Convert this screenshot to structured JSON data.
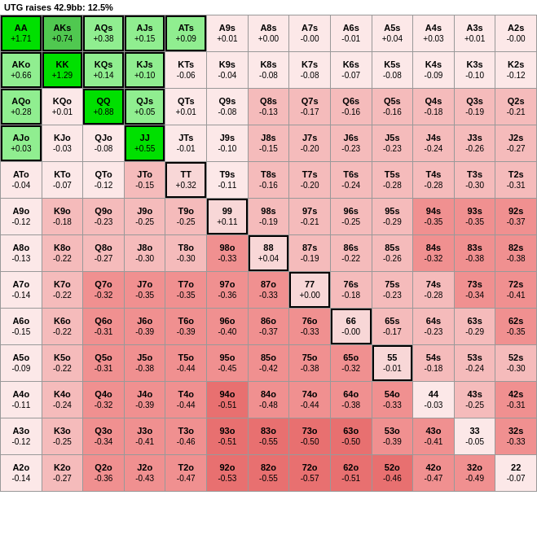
{
  "header": {
    "text": "UTG raises 42.9bb: 12.5%"
  },
  "cells": [
    {
      "name": "AA",
      "val": "+1.71",
      "style": "green-bright"
    },
    {
      "name": "AKs",
      "val": "+0.74",
      "style": "green-mid"
    },
    {
      "name": "AQs",
      "val": "+0.38",
      "style": "green-light"
    },
    {
      "name": "AJs",
      "val": "+0.15",
      "style": "green-light"
    },
    {
      "name": "ATs",
      "val": "+0.09",
      "style": "green-light"
    },
    {
      "name": "A9s",
      "val": "+0.01",
      "style": "pink-light"
    },
    {
      "name": "A8s",
      "val": "+0.00",
      "style": "pink-light"
    },
    {
      "name": "A7s",
      "val": "-0.00",
      "style": "pink-light"
    },
    {
      "name": "A6s",
      "val": "-0.01",
      "style": "pink-light"
    },
    {
      "name": "A5s",
      "val": "+0.04",
      "style": "pink-light"
    },
    {
      "name": "A4s",
      "val": "+0.03",
      "style": "pink-light"
    },
    {
      "name": "A3s",
      "val": "+0.01",
      "style": "pink-light"
    },
    {
      "name": "A2s",
      "val": "-0.00",
      "style": "pink-light"
    },
    {
      "name": "AKo",
      "val": "+0.66",
      "style": "green-light"
    },
    {
      "name": "KK",
      "val": "+1.29",
      "style": "green-bright"
    },
    {
      "name": "KQs",
      "val": "+0.14",
      "style": "green-light"
    },
    {
      "name": "KJs",
      "val": "+0.10",
      "style": "green-light"
    },
    {
      "name": "KTs",
      "val": "-0.06",
      "style": "pink-light"
    },
    {
      "name": "K9s",
      "val": "-0.04",
      "style": "pink-light"
    },
    {
      "name": "K8s",
      "val": "-0.08",
      "style": "pink-light"
    },
    {
      "name": "K7s",
      "val": "-0.08",
      "style": "pink-light"
    },
    {
      "name": "K6s",
      "val": "-0.07",
      "style": "pink-light"
    },
    {
      "name": "K5s",
      "val": "-0.08",
      "style": "pink-light"
    },
    {
      "name": "K4s",
      "val": "-0.09",
      "style": "pink-light"
    },
    {
      "name": "K3s",
      "val": "-0.10",
      "style": "pink-light"
    },
    {
      "name": "K2s",
      "val": "-0.12",
      "style": "pink-light"
    },
    {
      "name": "AQo",
      "val": "+0.28",
      "style": "green-light"
    },
    {
      "name": "KQo",
      "val": "+0.01",
      "style": "pink-light"
    },
    {
      "name": "QQ",
      "val": "+0.88",
      "style": "green-bright"
    },
    {
      "name": "QJs",
      "val": "+0.05",
      "style": "green-light"
    },
    {
      "name": "QTs",
      "val": "+0.01",
      "style": "pink-light"
    },
    {
      "name": "Q9s",
      "val": "-0.08",
      "style": "pink-light"
    },
    {
      "name": "Q8s",
      "val": "-0.13",
      "style": "pink-med"
    },
    {
      "name": "Q7s",
      "val": "-0.17",
      "style": "pink-med"
    },
    {
      "name": "Q6s",
      "val": "-0.16",
      "style": "pink-med"
    },
    {
      "name": "Q5s",
      "val": "-0.16",
      "style": "pink-med"
    },
    {
      "name": "Q4s",
      "val": "-0.18",
      "style": "pink-med"
    },
    {
      "name": "Q3s",
      "val": "-0.19",
      "style": "pink-med"
    },
    {
      "name": "Q2s",
      "val": "-0.21",
      "style": "pink-med"
    },
    {
      "name": "AJo",
      "val": "+0.03",
      "style": "green-light"
    },
    {
      "name": "KJo",
      "val": "-0.03",
      "style": "pink-light"
    },
    {
      "name": "QJo",
      "val": "-0.08",
      "style": "pink-light"
    },
    {
      "name": "JJ",
      "val": "+0.55",
      "style": "green-bright"
    },
    {
      "name": "JTs",
      "val": "-0.01",
      "style": "pink-light"
    },
    {
      "name": "J9s",
      "val": "-0.10",
      "style": "pink-light"
    },
    {
      "name": "J8s",
      "val": "-0.15",
      "style": "pink-med"
    },
    {
      "name": "J7s",
      "val": "-0.20",
      "style": "pink-med"
    },
    {
      "name": "J6s",
      "val": "-0.23",
      "style": "pink-med"
    },
    {
      "name": "J5s",
      "val": "-0.23",
      "style": "pink-med"
    },
    {
      "name": "J4s",
      "val": "-0.24",
      "style": "pink-med"
    },
    {
      "name": "J3s",
      "val": "-0.26",
      "style": "pink-med"
    },
    {
      "name": "J2s",
      "val": "-0.27",
      "style": "pink-med"
    },
    {
      "name": "ATo",
      "val": "-0.04",
      "style": "pink-light"
    },
    {
      "name": "KTo",
      "val": "-0.07",
      "style": "pink-light"
    },
    {
      "name": "QTo",
      "val": "-0.12",
      "style": "pink-light"
    },
    {
      "name": "JTo",
      "val": "-0.15",
      "style": "pink-med"
    },
    {
      "name": "TT",
      "val": "+0.32",
      "style": "outlined"
    },
    {
      "name": "T9s",
      "val": "-0.11",
      "style": "pink-light"
    },
    {
      "name": "T8s",
      "val": "-0.16",
      "style": "pink-med"
    },
    {
      "name": "T7s",
      "val": "-0.20",
      "style": "pink-med"
    },
    {
      "name": "T6s",
      "val": "-0.24",
      "style": "pink-med"
    },
    {
      "name": "T5s",
      "val": "-0.28",
      "style": "pink-med"
    },
    {
      "name": "T4s",
      "val": "-0.28",
      "style": "pink-med"
    },
    {
      "name": "T3s",
      "val": "-0.30",
      "style": "pink-med"
    },
    {
      "name": "T2s",
      "val": "-0.31",
      "style": "pink-med"
    },
    {
      "name": "A9o",
      "val": "-0.12",
      "style": "pink-light"
    },
    {
      "name": "K9o",
      "val": "-0.18",
      "style": "pink-med"
    },
    {
      "name": "Q9o",
      "val": "-0.23",
      "style": "pink-med"
    },
    {
      "name": "J9o",
      "val": "-0.25",
      "style": "pink-med"
    },
    {
      "name": "T9o",
      "val": "-0.25",
      "style": "pink-med"
    },
    {
      "name": "99",
      "val": "+0.11",
      "style": "outlined"
    },
    {
      "name": "98s",
      "val": "-0.19",
      "style": "pink-med"
    },
    {
      "name": "97s",
      "val": "-0.21",
      "style": "pink-med"
    },
    {
      "name": "96s",
      "val": "-0.25",
      "style": "pink-med"
    },
    {
      "name": "95s",
      "val": "-0.29",
      "style": "pink-med"
    },
    {
      "name": "94s",
      "val": "-0.35",
      "style": "pink-dark"
    },
    {
      "name": "93s",
      "val": "-0.35",
      "style": "pink-dark"
    },
    {
      "name": "92s",
      "val": "-0.37",
      "style": "pink-dark"
    },
    {
      "name": "A8o",
      "val": "-0.13",
      "style": "pink-light"
    },
    {
      "name": "K8o",
      "val": "-0.22",
      "style": "pink-med"
    },
    {
      "name": "Q8o",
      "val": "-0.27",
      "style": "pink-med"
    },
    {
      "name": "J8o",
      "val": "-0.30",
      "style": "pink-med"
    },
    {
      "name": "T8o",
      "val": "-0.30",
      "style": "pink-med"
    },
    {
      "name": "98o",
      "val": "-0.33",
      "style": "pink-dark"
    },
    {
      "name": "88",
      "val": "+0.04",
      "style": "outlined"
    },
    {
      "name": "87s",
      "val": "-0.19",
      "style": "pink-med"
    },
    {
      "name": "86s",
      "val": "-0.22",
      "style": "pink-med"
    },
    {
      "name": "85s",
      "val": "-0.26",
      "style": "pink-med"
    },
    {
      "name": "84s",
      "val": "-0.32",
      "style": "pink-dark"
    },
    {
      "name": "83s",
      "val": "-0.38",
      "style": "pink-dark"
    },
    {
      "name": "82s",
      "val": "-0.38",
      "style": "pink-dark"
    },
    {
      "name": "A7o",
      "val": "-0.14",
      "style": "pink-light"
    },
    {
      "name": "K7o",
      "val": "-0.22",
      "style": "pink-med"
    },
    {
      "name": "Q7o",
      "val": "-0.32",
      "style": "pink-dark"
    },
    {
      "name": "J7o",
      "val": "-0.35",
      "style": "pink-dark"
    },
    {
      "name": "T7o",
      "val": "-0.35",
      "style": "pink-dark"
    },
    {
      "name": "97o",
      "val": "-0.36",
      "style": "pink-dark"
    },
    {
      "name": "87o",
      "val": "-0.33",
      "style": "pink-dark"
    },
    {
      "name": "77",
      "val": "+0.00",
      "style": "outlined"
    },
    {
      "name": "76s",
      "val": "-0.18",
      "style": "pink-med"
    },
    {
      "name": "75s",
      "val": "-0.23",
      "style": "pink-med"
    },
    {
      "name": "74s",
      "val": "-0.28",
      "style": "pink-med"
    },
    {
      "name": "73s",
      "val": "-0.34",
      "style": "pink-dark"
    },
    {
      "name": "72s",
      "val": "-0.41",
      "style": "pink-dark"
    },
    {
      "name": "A6o",
      "val": "-0.15",
      "style": "pink-light"
    },
    {
      "name": "K6o",
      "val": "-0.22",
      "style": "pink-med"
    },
    {
      "name": "Q6o",
      "val": "-0.31",
      "style": "pink-dark"
    },
    {
      "name": "J6o",
      "val": "-0.39",
      "style": "pink-dark"
    },
    {
      "name": "T6o",
      "val": "-0.39",
      "style": "pink-dark"
    },
    {
      "name": "96o",
      "val": "-0.40",
      "style": "pink-dark"
    },
    {
      "name": "86o",
      "val": "-0.37",
      "style": "pink-dark"
    },
    {
      "name": "76o",
      "val": "-0.33",
      "style": "pink-dark"
    },
    {
      "name": "66",
      "val": "-0.00",
      "style": "outlined"
    },
    {
      "name": "65s",
      "val": "-0.17",
      "style": "pink-med"
    },
    {
      "name": "64s",
      "val": "-0.23",
      "style": "pink-med"
    },
    {
      "name": "63s",
      "val": "-0.29",
      "style": "pink-med"
    },
    {
      "name": "62s",
      "val": "-0.35",
      "style": "pink-dark"
    },
    {
      "name": "A5o",
      "val": "-0.09",
      "style": "pink-light"
    },
    {
      "name": "K5o",
      "val": "-0.22",
      "style": "pink-med"
    },
    {
      "name": "Q5o",
      "val": "-0.31",
      "style": "pink-dark"
    },
    {
      "name": "J5o",
      "val": "-0.38",
      "style": "pink-dark"
    },
    {
      "name": "T5o",
      "val": "-0.44",
      "style": "pink-dark"
    },
    {
      "name": "95o",
      "val": "-0.45",
      "style": "pink-dark"
    },
    {
      "name": "85o",
      "val": "-0.42",
      "style": "pink-dark"
    },
    {
      "name": "75o",
      "val": "-0.38",
      "style": "pink-dark"
    },
    {
      "name": "65o",
      "val": "-0.32",
      "style": "pink-dark"
    },
    {
      "name": "55",
      "val": "-0.01",
      "style": "outlined"
    },
    {
      "name": "54s",
      "val": "-0.18",
      "style": "pink-med"
    },
    {
      "name": "53s",
      "val": "-0.24",
      "style": "pink-med"
    },
    {
      "name": "52s",
      "val": "-0.30",
      "style": "pink-med"
    },
    {
      "name": "A4o",
      "val": "-0.11",
      "style": "pink-light"
    },
    {
      "name": "K4o",
      "val": "-0.24",
      "style": "pink-med"
    },
    {
      "name": "Q4o",
      "val": "-0.32",
      "style": "pink-dark"
    },
    {
      "name": "J4o",
      "val": "-0.39",
      "style": "pink-dark"
    },
    {
      "name": "T4o",
      "val": "-0.44",
      "style": "pink-dark"
    },
    {
      "name": "94o",
      "val": "-0.51",
      "style": "pink-darker"
    },
    {
      "name": "84o",
      "val": "-0.48",
      "style": "pink-dark"
    },
    {
      "name": "74o",
      "val": "-0.44",
      "style": "pink-dark"
    },
    {
      "name": "64o",
      "val": "-0.38",
      "style": "pink-dark"
    },
    {
      "name": "54o",
      "val": "-0.33",
      "style": "pink-dark"
    },
    {
      "name": "44",
      "val": "-0.03",
      "style": "pink-light"
    },
    {
      "name": "43s",
      "val": "-0.25",
      "style": "pink-med"
    },
    {
      "name": "42s",
      "val": "-0.31",
      "style": "pink-dark"
    },
    {
      "name": "A3o",
      "val": "-0.12",
      "style": "pink-light"
    },
    {
      "name": "K3o",
      "val": "-0.25",
      "style": "pink-med"
    },
    {
      "name": "Q3o",
      "val": "-0.34",
      "style": "pink-dark"
    },
    {
      "name": "J3o",
      "val": "-0.41",
      "style": "pink-dark"
    },
    {
      "name": "T3o",
      "val": "-0.46",
      "style": "pink-dark"
    },
    {
      "name": "93o",
      "val": "-0.51",
      "style": "pink-darker"
    },
    {
      "name": "83o",
      "val": "-0.55",
      "style": "pink-darker"
    },
    {
      "name": "73o",
      "val": "-0.50",
      "style": "pink-darker"
    },
    {
      "name": "63o",
      "val": "-0.50",
      "style": "pink-darker"
    },
    {
      "name": "53o",
      "val": "-0.39",
      "style": "pink-dark"
    },
    {
      "name": "43o",
      "val": "-0.41",
      "style": "pink-dark"
    },
    {
      "name": "33",
      "val": "-0.05",
      "style": "pink-light"
    },
    {
      "name": "32s",
      "val": "-0.33",
      "style": "pink-dark"
    },
    {
      "name": "A2o",
      "val": "-0.14",
      "style": "pink-light"
    },
    {
      "name": "K2o",
      "val": "-0.27",
      "style": "pink-med"
    },
    {
      "name": "Q2o",
      "val": "-0.36",
      "style": "pink-dark"
    },
    {
      "name": "J2o",
      "val": "-0.43",
      "style": "pink-dark"
    },
    {
      "name": "T2o",
      "val": "-0.47",
      "style": "pink-dark"
    },
    {
      "name": "92o",
      "val": "-0.53",
      "style": "pink-darker"
    },
    {
      "name": "82o",
      "val": "-0.55",
      "style": "pink-darker"
    },
    {
      "name": "72o",
      "val": "-0.57",
      "style": "pink-darker"
    },
    {
      "name": "62o",
      "val": "-0.51",
      "style": "pink-darker"
    },
    {
      "name": "52o",
      "val": "-0.46",
      "style": "pink-darker"
    },
    {
      "name": "42o",
      "val": "-0.47",
      "style": "pink-dark"
    },
    {
      "name": "32o",
      "val": "-0.49",
      "style": "pink-dark"
    },
    {
      "name": "22",
      "val": "-0.07",
      "style": "pink-light"
    }
  ]
}
